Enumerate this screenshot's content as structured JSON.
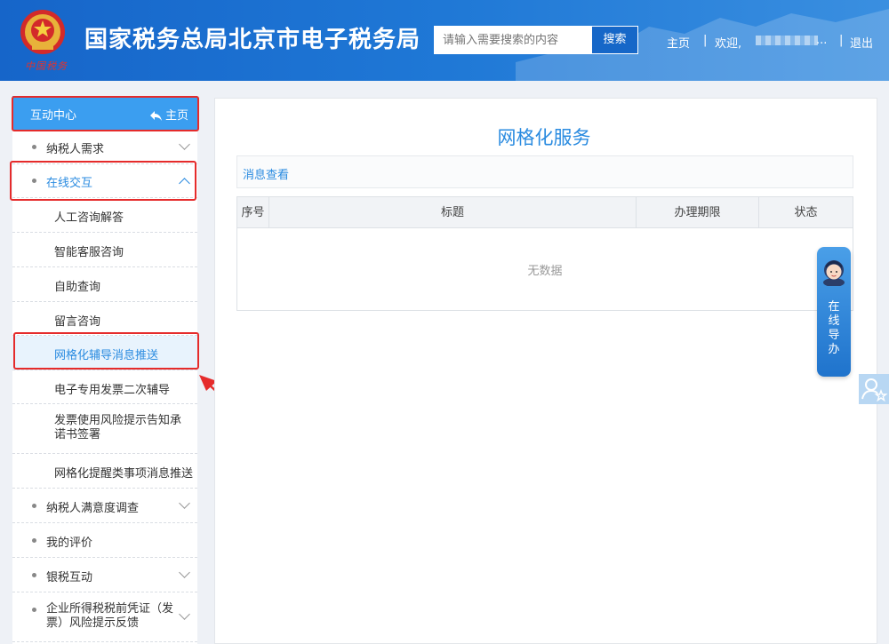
{
  "header": {
    "emblem_sign": "中国税务",
    "site_title": "国家税务总局北京市电子税务局",
    "search_placeholder": "请输入需要搜索的内容",
    "search_button": "搜索",
    "nav_home": "主页",
    "sep1": "|",
    "welcome": "欢迎,",
    "ellipsis": "...",
    "sep2": "|",
    "logout": "退出"
  },
  "sidebar": {
    "title": "互动中心",
    "home": "主页",
    "items": [
      {
        "label": "纳税人需求"
      },
      {
        "label": "在线交互"
      },
      {
        "label": "人工咨询解答"
      },
      {
        "label": "智能客服咨询"
      },
      {
        "label": "自助查询"
      },
      {
        "label": "留言咨询"
      },
      {
        "label": "网格化辅导消息推送"
      },
      {
        "label": "电子专用发票二次辅导"
      },
      {
        "label": "发票使用风险提示告知承诺书签署"
      },
      {
        "label": "网格化提醒类事项消息推送"
      },
      {
        "label": "纳税人满意度调查"
      },
      {
        "label": "我的评价"
      },
      {
        "label": "银税互动"
      },
      {
        "label": "企业所得税税前凭证（发票）风险提示反馈"
      }
    ]
  },
  "main": {
    "title": "网格化服务",
    "subtitle": "消息查看",
    "columns": [
      "序号",
      "标题",
      "办理期限",
      "状态"
    ],
    "empty_text": "无数据"
  },
  "guide": {
    "text": "在线导办"
  },
  "colors": {
    "header_blue": "#1f78d6",
    "accent": "#2a8be0",
    "annotation_red": "#e52b2b"
  }
}
